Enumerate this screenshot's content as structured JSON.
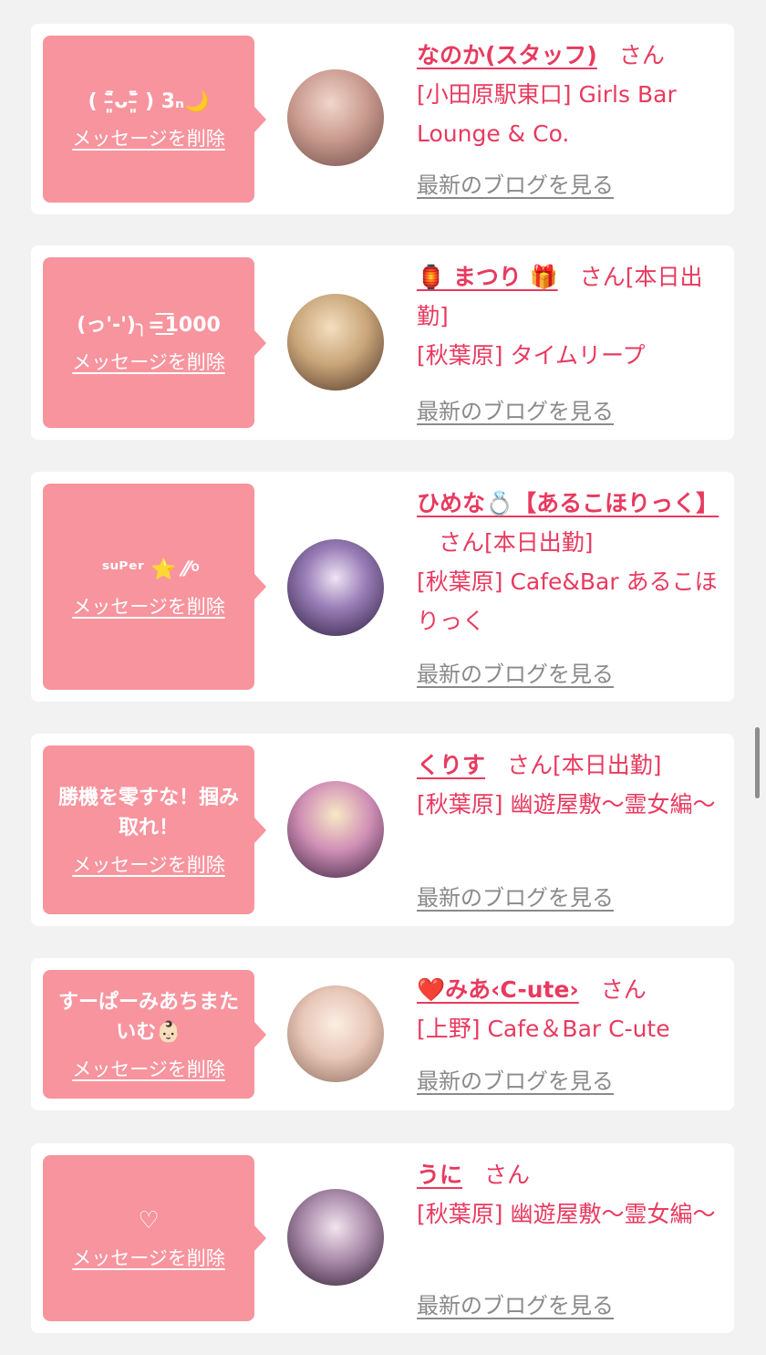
{
  "delete_label": "メッセージを削除",
  "blog_label": "最新のブログを見る",
  "san_suffix": "さん",
  "entries": [
    {
      "message": "( ˭̵̵̵̵̵̵͈᷄ᴗ˭̵̵̵̵̵̵͈᷅ ) 3ₙ🌙",
      "name": "なのか(スタッフ)",
      "status": "",
      "shop": "[小田原駅東口] Girls Bar Lounge & Co."
    },
    {
      "message": "(っ'-')╮=͟͟͞͞1000",
      "name": "🏮 まつり 🎁",
      "status": "[本日出勤]",
      "shop": "[秋葉原] タイムリープ"
    },
    {
      "message": "ˢᵘᴾᵉʳ ⭐ ⁄⁄ ͦ",
      "name": "ひめな💍【あるこほりっく】",
      "status": "[本日出勤]",
      "shop": "[秋葉原] Cafe&Bar あるこほりっく"
    },
    {
      "message": "勝機を零すな！掴み取れ！",
      "name": "くりす",
      "status": "[本日出勤]",
      "shop": "[秋葉原] 幽遊屋敷〜霊女編〜"
    },
    {
      "message": "すーぱーみあちまたいむ👶🏻",
      "name": "❤️みあ‹C-ute›",
      "status": "",
      "shop": "[上野] Cafe＆Bar C-ute"
    },
    {
      "message": "♡",
      "name": "うに",
      "status": "",
      "shop": "[秋葉原] 幽遊屋敷〜霊女編〜"
    }
  ],
  "colors": {
    "accent": "#e83a5f",
    "bubble": "#f7949e",
    "background": "#f2f2f2"
  }
}
